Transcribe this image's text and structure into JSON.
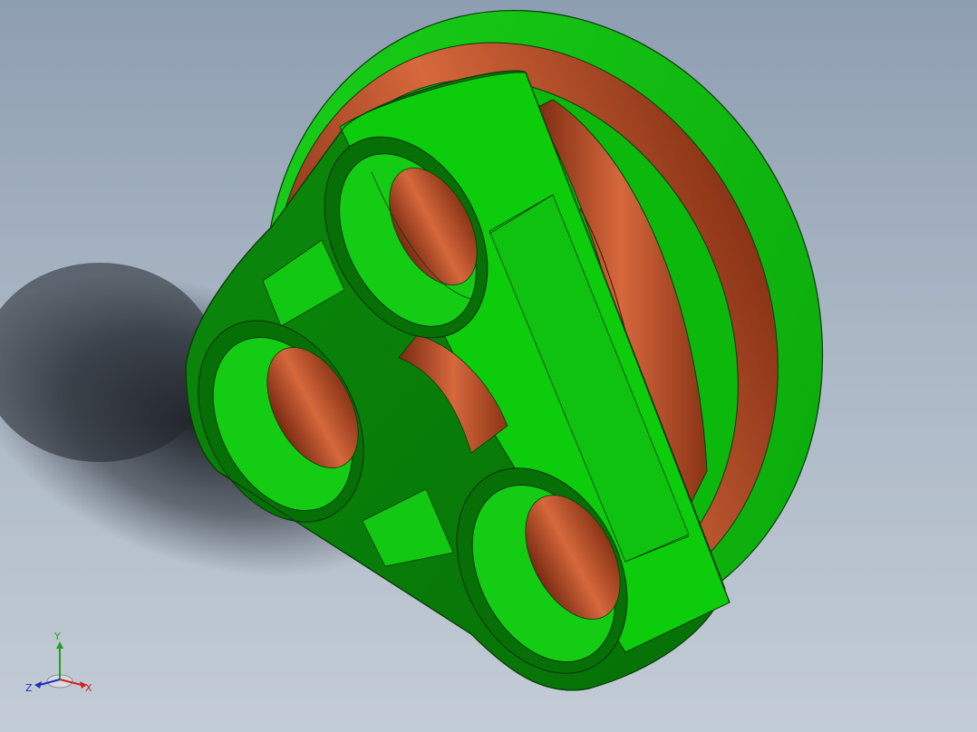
{
  "viewport": {
    "background_top": "#8e9eb1",
    "background_bottom": "#c3ccd6"
  },
  "model": {
    "primary_color": "#0cc00c",
    "shade_color": "#067a06",
    "fillet_color": "#b8502c",
    "edge_color": "#0a3a0a"
  },
  "triad": {
    "x_label": "X",
    "y_label": "Y",
    "z_label": "Z",
    "x_color": "#d42020",
    "y_color": "#20a020",
    "z_color": "#2030c0"
  }
}
